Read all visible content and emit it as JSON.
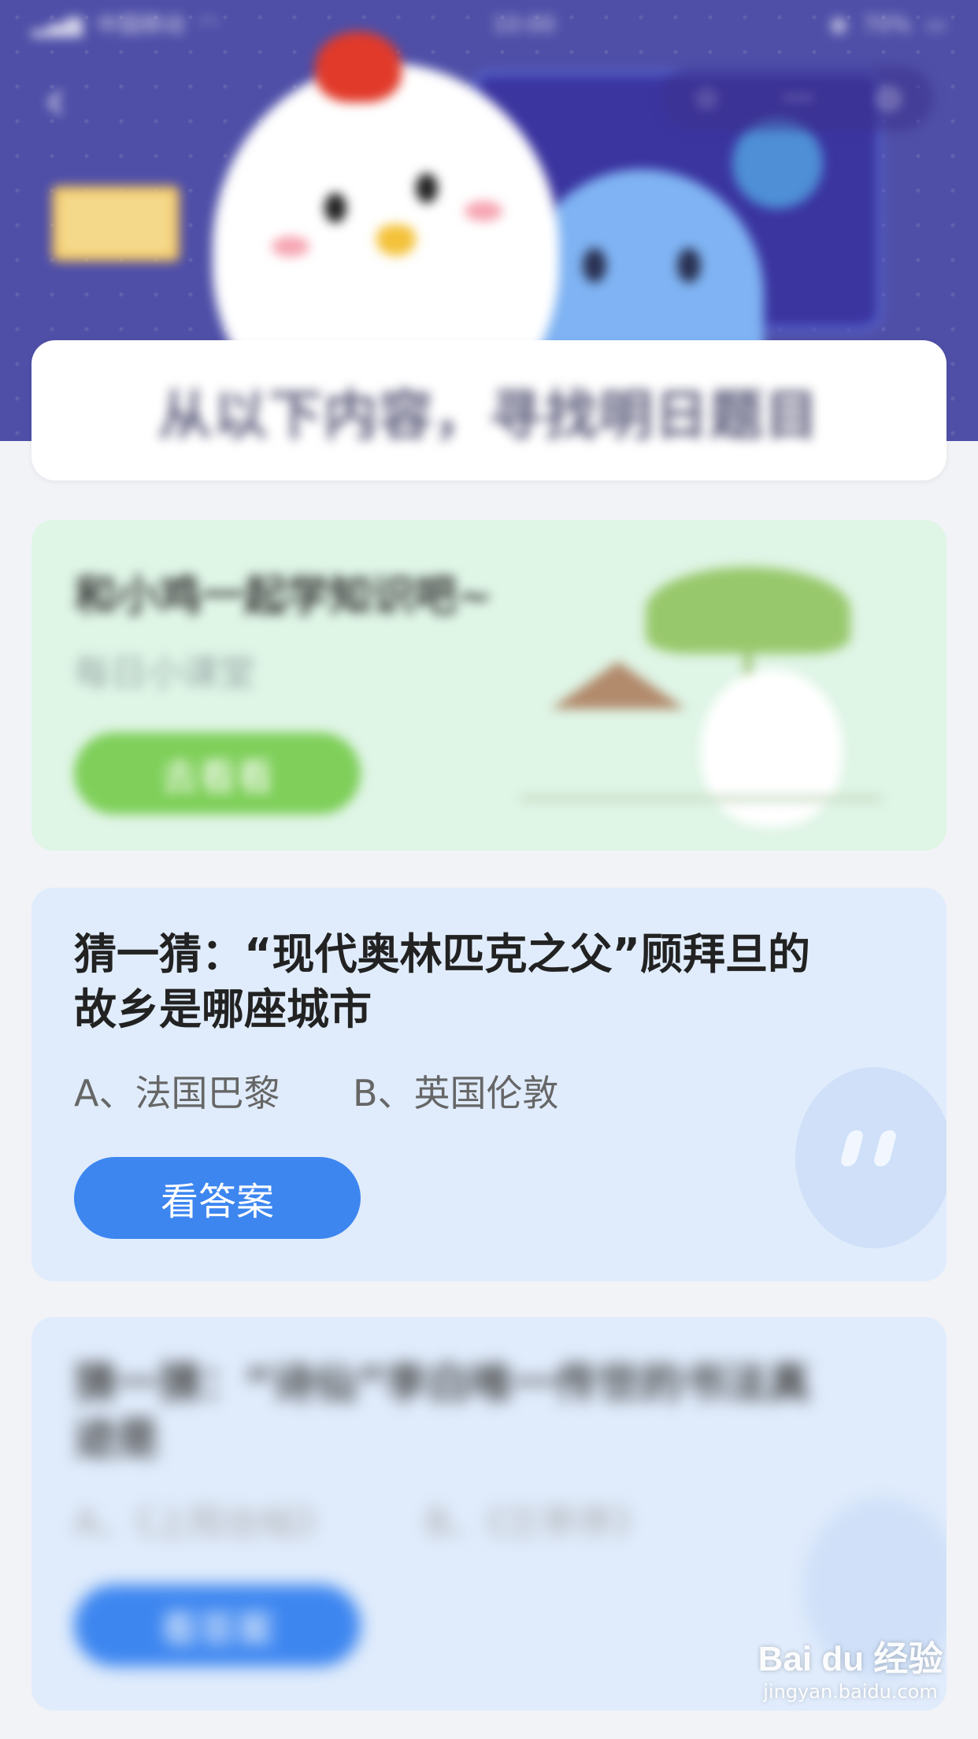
{
  "status_bar": {
    "carrier": "中国移动",
    "time": "10:00",
    "battery": "70%"
  },
  "nav": {
    "back_icon": "chevron-left-icon",
    "capsule_icons": [
      "star-icon",
      "more-icon",
      "close-circle-icon"
    ],
    "capsule_more": "···"
  },
  "hero": {
    "title": "从以下内容，寻找明日题目"
  },
  "lesson_card": {
    "title": "和小鸡一起学知识吧~",
    "subtitle": "每日小课堂",
    "button": "去看看",
    "accent": "#7fcf5a"
  },
  "quiz_card": {
    "question": "猜一猜：“现代奥林匹克之父”顾拜旦的故乡是哪座城市",
    "question_line1": "猜一猜：“现代奥林匹克之父”顾拜旦的",
    "question_line2": "故乡是哪座城市",
    "option_a": "A、法国巴黎",
    "option_b": "B、英国伦敦",
    "button": "看答案",
    "accent": "#3d86f0"
  },
  "next_card": {
    "question_line1": "猜一猜：“诗仙”李白唯一传世的书法真",
    "question_line2": "迹是",
    "option_a": "A、《上阳台帖》",
    "option_b": "B、《兰亭序》",
    "button": "看答案"
  },
  "watermark": {
    "logo": "Bai du 经验",
    "url": "jingyan.baidu.com"
  }
}
